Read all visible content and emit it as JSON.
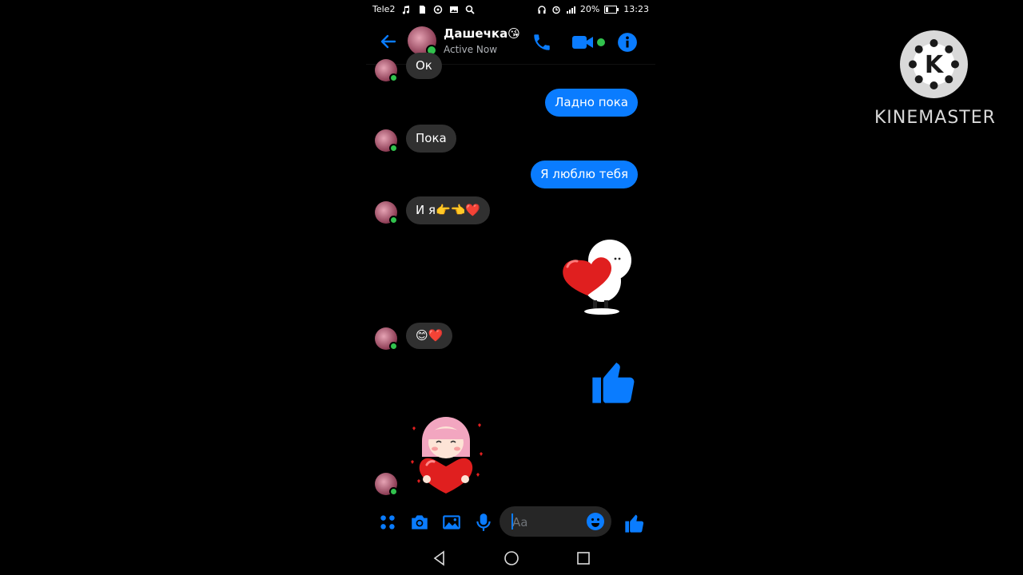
{
  "status_bar": {
    "carrier": "Tele2",
    "battery": "20%",
    "time": "13:23"
  },
  "header": {
    "contact_name": "Дашечка😘",
    "status": "Active Now"
  },
  "messages": {
    "m1": "Ок",
    "m2": "Ладно пока",
    "m3": "Пока",
    "m4": "Я люблю тебя",
    "m5": "И я👉👈❤️",
    "m6": "😊❤️"
  },
  "composer": {
    "placeholder": "Aa"
  },
  "watermark": {
    "logo_letter": "K",
    "text_kine": "KINE",
    "text_master": "MASTER"
  },
  "colors": {
    "accent": "#0a7cff",
    "incoming_bubble": "#303030",
    "online": "#31c24d"
  }
}
